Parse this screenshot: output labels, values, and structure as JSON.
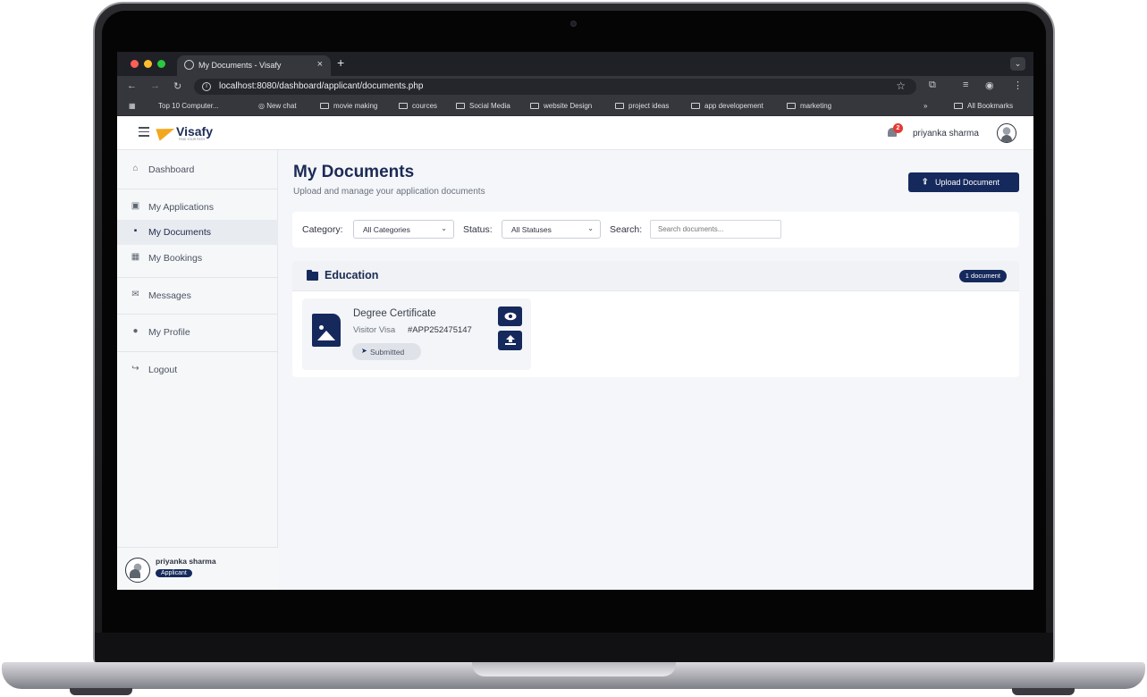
{
  "browser": {
    "tab_title": "My Documents - Visafy",
    "tab_close": "×",
    "new_tab": "+",
    "url": "localhost:8080/dashboard/applicant/documents.php",
    "bookmarks": [
      {
        "label": "Top 10 Computer..."
      },
      {
        "label": "New chat"
      },
      {
        "label": "movie making"
      },
      {
        "label": "cources"
      },
      {
        "label": "Social Media"
      },
      {
        "label": "website Design"
      },
      {
        "label": "project ideas"
      },
      {
        "label": "app developement"
      },
      {
        "label": "marketing"
      }
    ],
    "overflow": "»",
    "all_bookmarks": "All Bookmarks"
  },
  "header": {
    "brand": "Visafy",
    "tagline": "FIND YOUR PATH",
    "notification_count": "2",
    "user_name": "priyanka sharma"
  },
  "sidebar": {
    "items": [
      {
        "label": "Dashboard",
        "icon": "home-icon"
      },
      {
        "label": "My Applications",
        "icon": "folder-icon"
      },
      {
        "label": "My Documents",
        "icon": "document-icon"
      },
      {
        "label": "My Bookings",
        "icon": "calendar-icon"
      },
      {
        "label": "Messages",
        "icon": "envelope-icon"
      },
      {
        "label": "My Profile",
        "icon": "user-icon"
      },
      {
        "label": "Logout",
        "icon": "logout-icon"
      }
    ],
    "footer_name": "priyanka sharma",
    "footer_role": "Applicant"
  },
  "main": {
    "title": "My Documents",
    "subtitle": "Upload and manage your application documents",
    "upload_button": "Upload Document",
    "filters": {
      "category_label": "Category:",
      "category_value": "All Categories",
      "status_label": "Status:",
      "status_value": "All Statuses",
      "search_label": "Search:",
      "search_placeholder": "Search documents..."
    },
    "category": {
      "title": "Education",
      "count": "1 document",
      "documents": [
        {
          "name": "Degree Certificate",
          "visa": "Visitor Visa",
          "application": "#APP252475147",
          "status": "Submitted"
        }
      ]
    }
  },
  "colors": {
    "primary": "#15295c",
    "accent": "#f2a81d",
    "badge": "#e53935"
  }
}
